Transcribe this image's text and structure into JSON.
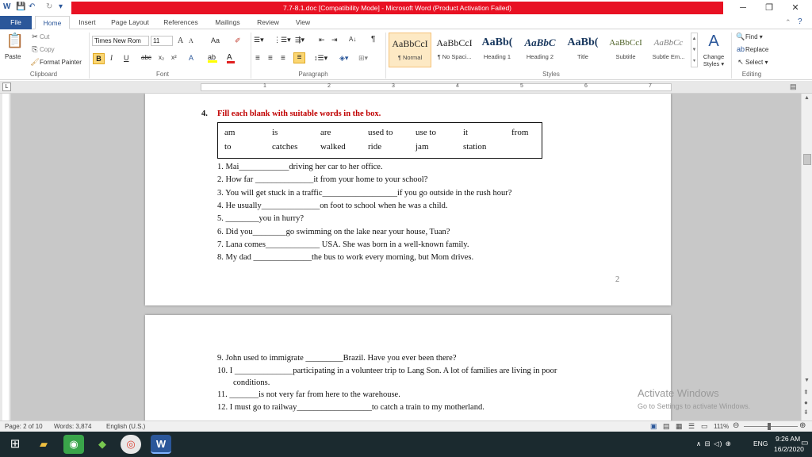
{
  "window": {
    "title": "7.7-8.1.doc [Compatibility Mode] - Microsoft Word (Product Activation Failed)",
    "min_glyph": "─",
    "restore_glyph": "❐",
    "close_glyph": "✕"
  },
  "qat": {
    "word_icon": "W",
    "save_icon": "💾",
    "undo_icon": "↶",
    "redo_icon": "↻",
    "more_icon": "▾"
  },
  "tabs": [
    "File",
    "Home",
    "Insert",
    "Page Layout",
    "References",
    "Mailings",
    "Review",
    "View"
  ],
  "ribbon": {
    "clipboard": {
      "paste": "Paste",
      "cut": "Cut",
      "copy": "Copy",
      "format_painter": "Format Painter",
      "label": "Clipboard"
    },
    "font": {
      "name": "Times New Rom",
      "size": "11",
      "label": "Font",
      "bold": "B",
      "italic": "I",
      "underline": "U",
      "strike": "abc",
      "sub": "x₂",
      "sup": "x²",
      "grow": "A",
      "shrink": "A",
      "case": "Aa",
      "clear": "✐"
    },
    "paragraph": {
      "label": "Paragraph",
      "pilcrow": "¶",
      "sort": "A↓"
    },
    "styles": {
      "label": "Styles",
      "items": [
        {
          "sample": "AaBbCcI",
          "name": "¶ Normal"
        },
        {
          "sample": "AaBbCcI",
          "name": "¶ No Spaci..."
        },
        {
          "sample": "AaBb(",
          "name": "Heading 1"
        },
        {
          "sample": "AaBbC",
          "name": "Heading 2"
        },
        {
          "sample": "AaBb(",
          "name": "Title"
        },
        {
          "sample": "AaBbCcI",
          "name": "Subtitle"
        },
        {
          "sample": "AaBbCc",
          "name": "Subtle Em..."
        }
      ],
      "change_styles": "Change Styles ▾"
    },
    "editing": {
      "label": "Editing",
      "find": "Find ▾",
      "replace": "Replace",
      "select": "Select ▾"
    }
  },
  "ruler": {
    "numbers": [
      "1",
      "2",
      "3",
      "4",
      "5",
      "6",
      "7"
    ]
  },
  "document": {
    "page2": {
      "exercise_number": "4.",
      "exercise_title": "Fill each blank with suitable words in the box.",
      "box_row1": [
        "am",
        "is",
        "are",
        "used to",
        "use to",
        "it",
        "from"
      ],
      "box_row2": [
        "to",
        "catches",
        "walked",
        "ride",
        "jam",
        "station"
      ],
      "lines": [
        "1. Mai____________driving her car to her office.",
        "2. How far  ______________it from your home to your school?",
        "3. You will get stuck in a traffic__________________if you go outside in the rush hour?",
        "4. He usually______________on foot to school when he was a child.",
        "5. ________you in hurry?",
        "6. Did you________go swimming  on the lake near your house, Tuan?",
        "7. Lana comes_____________ USA. She was born in a well-known family.",
        "8. My dad ______________the bus to work every morning, but Mom drives."
      ],
      "page_number": "2"
    },
    "page3": {
      "lines": [
        "9. John used to immigrate  _________Brazil.  Have you ever been there?",
        "10. I ______________participating  in  a  volunteer  trip  to  Lang  Son.  A  lot  of  families  are  living  in  poor",
        "conditions.",
        "11. _______is not very far from here to the warehouse.",
        "12. I must go to railway__________________to catch a train to my motherland."
      ]
    }
  },
  "watermark": {
    "line1": "Activate Windows",
    "line2": "Go to Settings to activate Windows."
  },
  "status": {
    "page": "Page: 2 of 10",
    "words": "Words: 3,874",
    "language": "English (U.S.)",
    "zoom": "111%"
  },
  "taskbar": {
    "tray_icons": "∧  ⊟  ◁)  ⊕",
    "language": "ENG",
    "time": "9:26 AM",
    "date": "16/2/2020"
  }
}
